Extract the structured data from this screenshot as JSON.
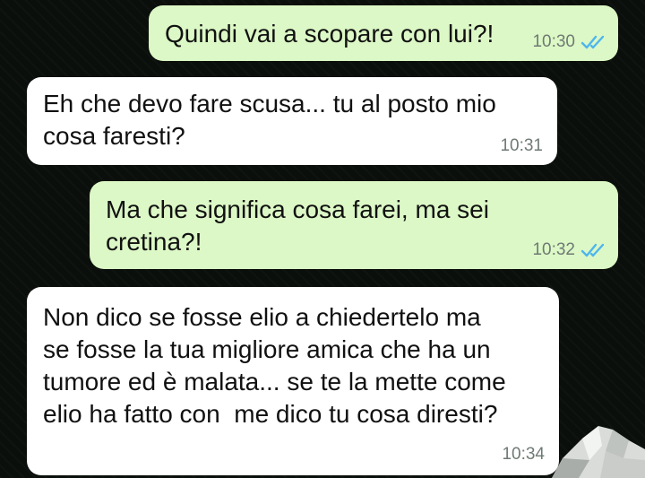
{
  "messages": [
    {
      "direction": "outgoing",
      "text": "Quindi vai a scopare con lui?!",
      "time": "10:30",
      "status": "read"
    },
    {
      "direction": "incoming",
      "text": "Eh che devo fare scusa... tu al posto mio\ncosa faresti?",
      "time": "10:31"
    },
    {
      "direction": "outgoing",
      "text": "Ma che significa cosa farei, ma sei\ncretina?!",
      "time": "10:32",
      "status": "read"
    },
    {
      "direction": "incoming",
      "text": "Non dico se fosse elio a chiedertelo ma\nse fosse la tua migliore amica che ha un\ntumore ed è malata... se te la mette come\nelio ha fatto con  me dico tu cosa diresti?",
      "time": "10:34"
    }
  ],
  "colors": {
    "outgoing_bubble": "#dcf8c6",
    "incoming_bubble": "#ffffff",
    "read_ticks": "#4fb6ec",
    "time_text": "#6f7a73"
  },
  "icons": {
    "read_status": "double-check-icon"
  }
}
